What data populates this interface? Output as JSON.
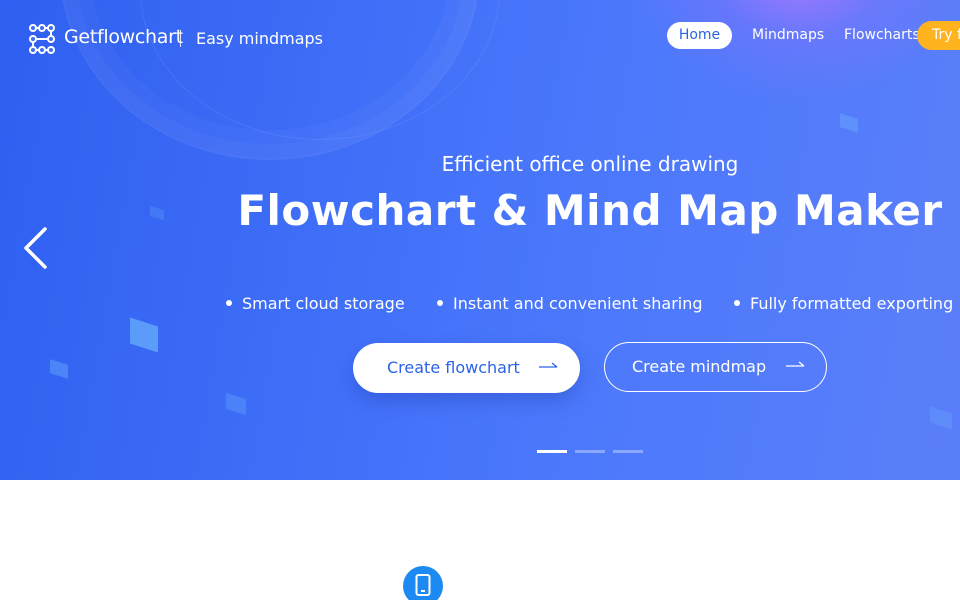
{
  "header": {
    "brand": "Getflowchart",
    "tagline": "Easy mindmaps",
    "nav": {
      "home": "Home",
      "mindmaps": "Mindmaps",
      "flowcharts": "Flowcharts",
      "try": "Try f"
    }
  },
  "hero": {
    "subtitle": "Efficient office online drawing",
    "headline": "Flowchart & Mind Map Maker",
    "features": [
      "Smart cloud storage",
      "Instant and convenient sharing",
      "Fully formatted exporting"
    ],
    "primary_cta": "Create flowchart",
    "secondary_cta": "Create mindmap",
    "slides": {
      "count": 3,
      "active": 1
    }
  },
  "colors": {
    "hero_start": "#2f5ff0",
    "hero_end": "#5b7ffa",
    "accent_blue": "#2a63e8",
    "try_button": "#ffb41f",
    "section_icon": "#1c8af2"
  },
  "icons": [
    "logo-icon",
    "chevron-left-icon",
    "arrow-right-icon",
    "tablet-icon"
  ]
}
